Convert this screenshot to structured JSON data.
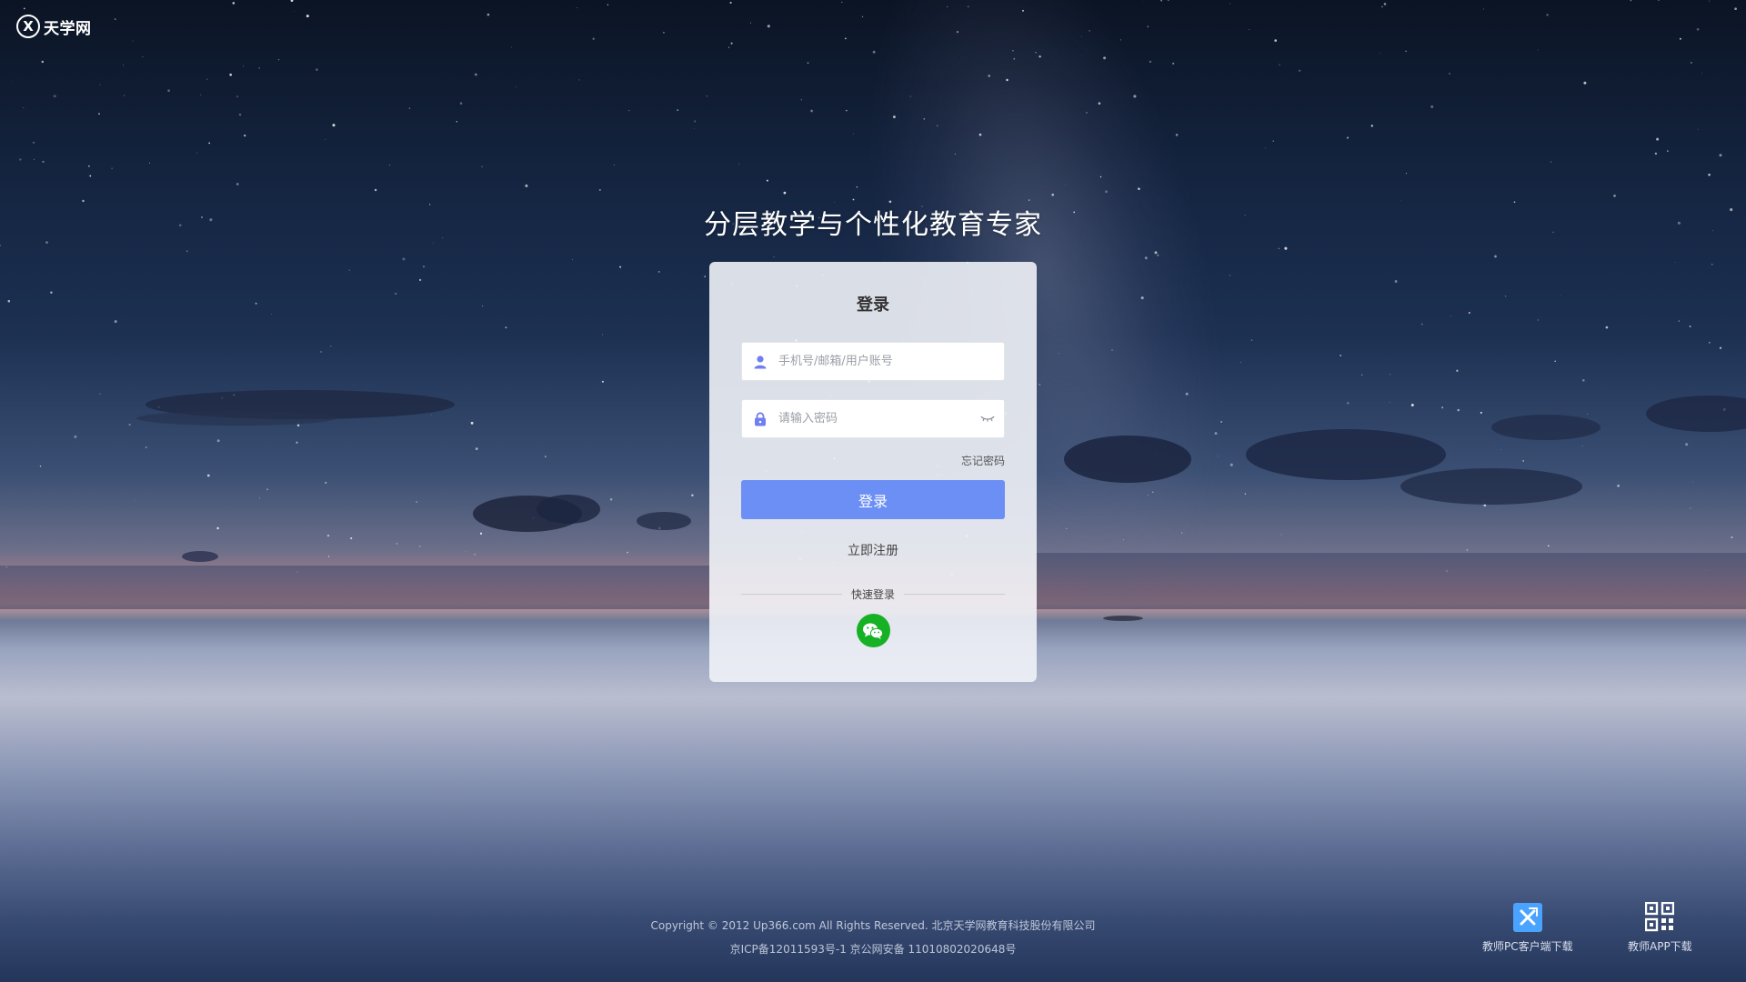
{
  "brand": {
    "logo_mark": "X",
    "name": "天学网"
  },
  "headline": "分层教学与个性化教育专家",
  "login": {
    "title": "登录",
    "account_placeholder": "手机号/邮箱/用户账号",
    "account_value": "",
    "password_placeholder": "请输入密码",
    "password_value": "",
    "forgot_label": "忘记密码",
    "submit_label": "登录",
    "register_label": "立即注册",
    "quick_login_label": "快速登录",
    "quick_login_methods": [
      "wechat-icon"
    ]
  },
  "footer": {
    "copyright": "Copyright © 2012 Up366.com All Rights Reserved. 北京天学网教育科技股份有限公司",
    "icp": "京ICP备12011593号-1 京公网安备 11010802020648号"
  },
  "downloads": [
    {
      "label": "教师PC客户端下载",
      "icon": "pc-client-icon"
    },
    {
      "label": "教师APP下载",
      "icon": "qr-code-icon"
    }
  ],
  "colors": {
    "primary_button": "#6b8ff4",
    "wechat_green": "#17b125",
    "input_icon": "#6f7ef0",
    "pc_client_icon_bg": "#4aa3ff"
  }
}
